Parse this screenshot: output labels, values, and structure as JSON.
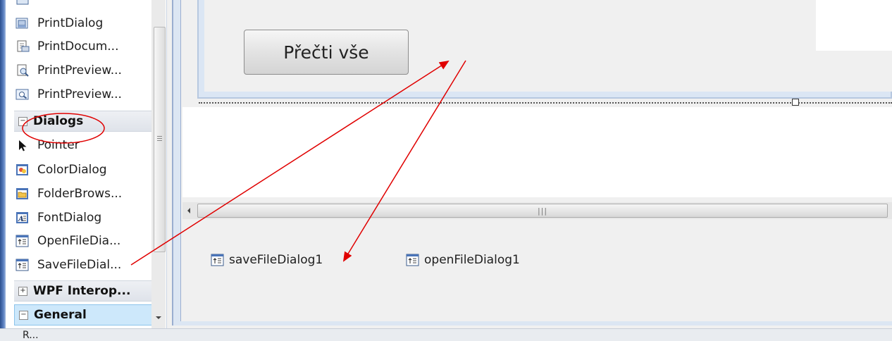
{
  "toolbox": {
    "items_top": [
      {
        "label": "PrintDialog",
        "icon": "print-dialog-icon"
      },
      {
        "label": "PrintDocum...",
        "icon": "print-document-icon"
      },
      {
        "label": "PrintPreview...",
        "icon": "print-preview-control-icon"
      },
      {
        "label": "PrintPreview...",
        "icon": "print-preview-dialog-icon"
      }
    ],
    "category_dialogs": "Dialogs",
    "dialog_items": [
      {
        "label": "Pointer",
        "icon": "pointer-icon"
      },
      {
        "label": "ColorDialog",
        "icon": "color-dialog-icon"
      },
      {
        "label": "FolderBrows...",
        "icon": "folder-browser-icon"
      },
      {
        "label": "FontDialog",
        "icon": "font-dialog-icon"
      },
      {
        "label": "OpenFileDia...",
        "icon": "open-file-dialog-icon"
      },
      {
        "label": "SaveFileDial...",
        "icon": "save-file-dialog-icon"
      }
    ],
    "category_wpf": "WPF Interop...",
    "category_general": "General"
  },
  "form": {
    "button_label": "Přečti vše"
  },
  "tray": {
    "components": [
      "saveFileDialog1",
      "openFileDialog1"
    ]
  },
  "statusbar": {
    "text": "R..."
  },
  "colors": {
    "annotation_red": "#e00000",
    "selected_category": "#cde8fb"
  }
}
